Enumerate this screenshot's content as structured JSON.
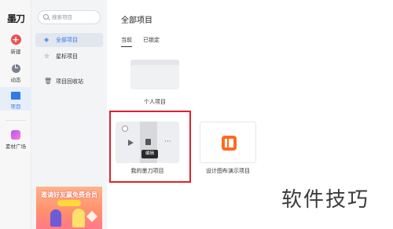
{
  "app": {
    "logo": "墨刀"
  },
  "rail": {
    "new": "新建",
    "dynamics": "动态",
    "projects": "项目",
    "materials": "素材广场"
  },
  "sidebar": {
    "search_placeholder": "搜索项目",
    "items": [
      {
        "label": "全部项目",
        "icon": "cube-icon",
        "active": true
      },
      {
        "label": "星标项目",
        "icon": "star-icon",
        "active": false
      },
      {
        "label": "项目回收站",
        "icon": "trash-icon",
        "active": false
      }
    ],
    "promo_text": "邀请好友赢免费会员"
  },
  "main": {
    "title": "全部项目",
    "tabs": [
      {
        "label": "当前",
        "active": true
      },
      {
        "label": "已锁定",
        "active": false
      }
    ],
    "folder_name": "个人项目",
    "projects": [
      {
        "name": "我的墨刀项目",
        "tooltip": "编辑"
      },
      {
        "name": "设计图布演示项目"
      }
    ]
  },
  "watermark": "软件技巧",
  "colors": {
    "accent": "#2f7be8",
    "highlight": "#e0202a",
    "brand_new": "#ef4f4f",
    "project_icon": "#ff6a1f"
  }
}
